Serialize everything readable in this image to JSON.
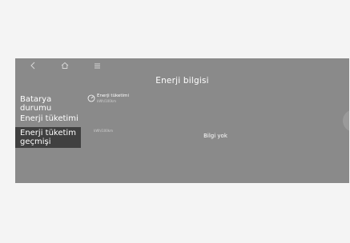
{
  "header": {
    "title": "Enerji bilgisi",
    "icons": [
      "back-icon",
      "home-icon",
      "menu-icon"
    ]
  },
  "sidebar": {
    "items": [
      {
        "label": "Batarya durumu"
      },
      {
        "label": "Enerji tüketimi"
      },
      {
        "label": "Enerji tüketim geçmişi",
        "selected": true
      }
    ]
  },
  "main": {
    "consumption_label": "Enerji tüketimi",
    "consumption_unit": "kWh/100km",
    "axis_unit": "kWh/100km",
    "no_info": "Bilgi yok"
  },
  "colors": {
    "screen_bg": "#8a8a8a",
    "selected_bg": "#404040",
    "page_bg": "#f4f4f4",
    "text": "#ffffff"
  }
}
